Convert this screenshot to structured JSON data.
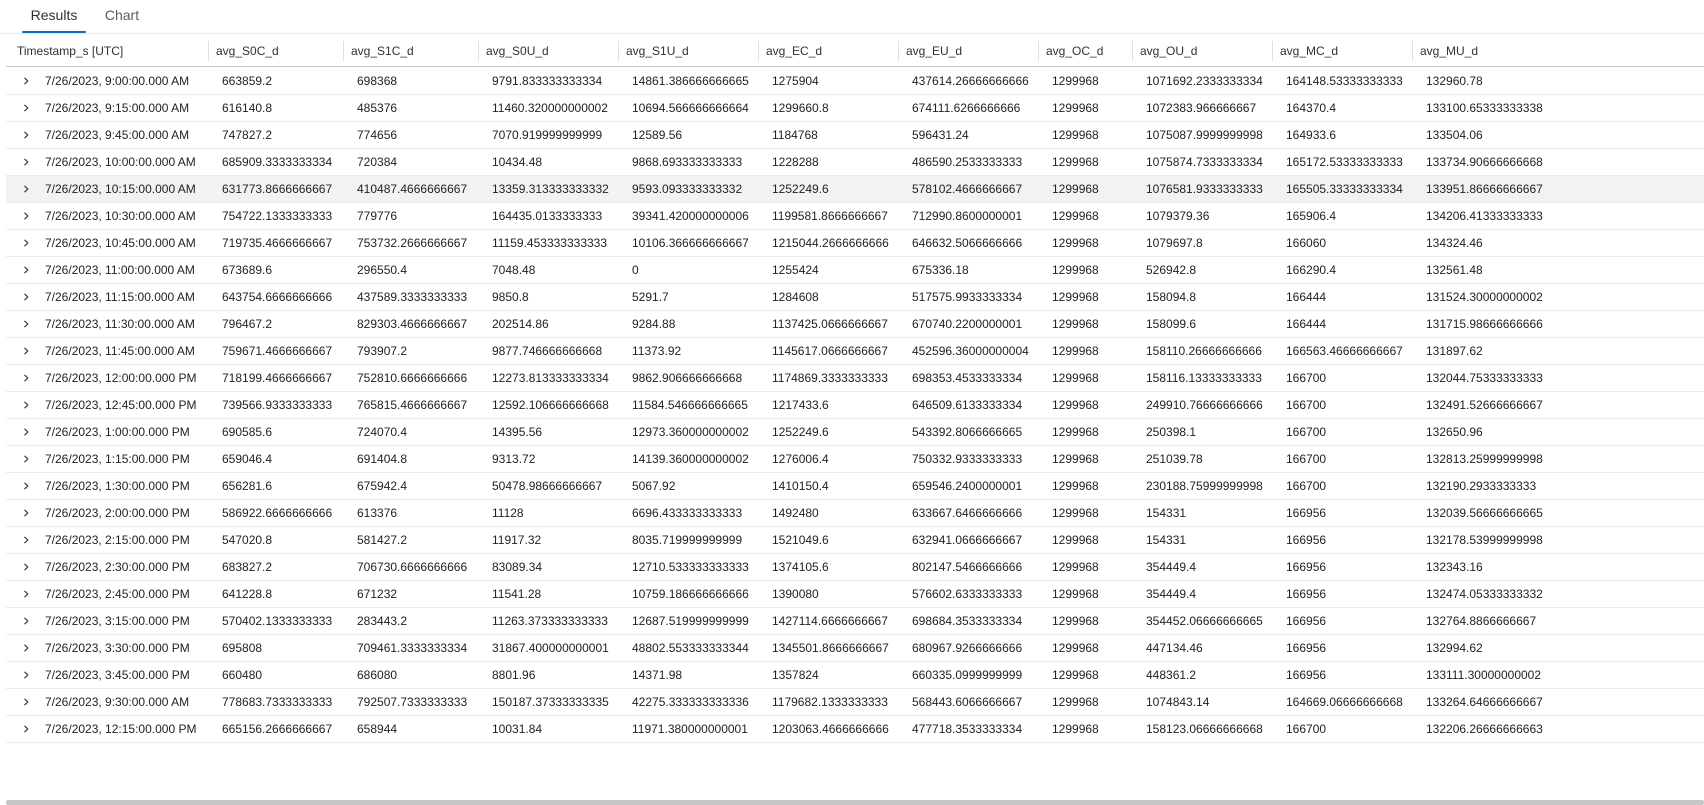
{
  "tabs": {
    "results_label": "Results",
    "chart_label": "Chart"
  },
  "columns": [
    "Timestamp_s [UTC]",
    "avg_S0C_d",
    "avg_S1C_d",
    "avg_S0U_d",
    "avg_S1U_d",
    "avg_EC_d",
    "avg_EU_d",
    "avg_OC_d",
    "avg_OU_d",
    "avg_MC_d",
    "avg_MU_d"
  ],
  "rows": [
    [
      "7/26/2023, 9:00:00.000 AM",
      "663859.2",
      "698368",
      "9791.833333333334",
      "14861.386666666665",
      "1275904",
      "437614.26666666666",
      "1299968",
      "1071692.2333333334",
      "164148.53333333333",
      "132960.78"
    ],
    [
      "7/26/2023, 9:15:00.000 AM",
      "616140.8",
      "485376",
      "11460.320000000002",
      "10694.566666666664",
      "1299660.8",
      "674111.6266666666",
      "1299968",
      "1072383.966666667",
      "164370.4",
      "133100.65333333338"
    ],
    [
      "7/26/2023, 9:45:00.000 AM",
      "747827.2",
      "774656",
      "7070.919999999999",
      "12589.56",
      "1184768",
      "596431.24",
      "1299968",
      "1075087.9999999998",
      "164933.6",
      "133504.06"
    ],
    [
      "7/26/2023, 10:00:00.000 AM",
      "685909.3333333334",
      "720384",
      "10434.48",
      "9868.693333333333",
      "1228288",
      "486590.2533333333",
      "1299968",
      "1075874.7333333334",
      "165172.53333333333",
      "133734.90666666668"
    ],
    [
      "7/26/2023, 10:15:00.000 AM",
      "631773.8666666667",
      "410487.4666666667",
      "13359.313333333332",
      "9593.093333333332",
      "1252249.6",
      "578102.4666666667",
      "1299968",
      "1076581.9333333333",
      "165505.33333333334",
      "133951.86666666667"
    ],
    [
      "7/26/2023, 10:30:00.000 AM",
      "754722.1333333333",
      "779776",
      "164435.0133333333",
      "39341.420000000006",
      "1199581.8666666667",
      "712990.8600000001",
      "1299968",
      "1079379.36",
      "165906.4",
      "134206.41333333333"
    ],
    [
      "7/26/2023, 10:45:00.000 AM",
      "719735.4666666667",
      "753732.2666666667",
      "11159.453333333333",
      "10106.366666666667",
      "1215044.2666666666",
      "646632.5066666666",
      "1299968",
      "1079697.8",
      "166060",
      "134324.46"
    ],
    [
      "7/26/2023, 11:00:00.000 AM",
      "673689.6",
      "296550.4",
      "7048.48",
      "0",
      "1255424",
      "675336.18",
      "1299968",
      "526942.8",
      "166290.4",
      "132561.48"
    ],
    [
      "7/26/2023, 11:15:00.000 AM",
      "643754.6666666666",
      "437589.3333333333",
      "9850.8",
      "5291.7",
      "1284608",
      "517575.9933333334",
      "1299968",
      "158094.8",
      "166444",
      "131524.30000000002"
    ],
    [
      "7/26/2023, 11:30:00.000 AM",
      "796467.2",
      "829303.4666666667",
      "202514.86",
      "9284.88",
      "1137425.0666666667",
      "670740.2200000001",
      "1299968",
      "158099.6",
      "166444",
      "131715.98666666666"
    ],
    [
      "7/26/2023, 11:45:00.000 AM",
      "759671.4666666667",
      "793907.2",
      "9877.746666666668",
      "11373.92",
      "1145617.0666666667",
      "452596.36000000004",
      "1299968",
      "158110.26666666666",
      "166563.46666666667",
      "131897.62"
    ],
    [
      "7/26/2023, 12:00:00.000 PM",
      "718199.4666666667",
      "752810.6666666666",
      "12273.813333333334",
      "9862.906666666668",
      "1174869.3333333333",
      "698353.4533333334",
      "1299968",
      "158116.13333333333",
      "166700",
      "132044.75333333333"
    ],
    [
      "7/26/2023, 12:45:00.000 PM",
      "739566.9333333333",
      "765815.4666666667",
      "12592.106666666668",
      "11584.546666666665",
      "1217433.6",
      "646509.6133333334",
      "1299968",
      "249910.76666666666",
      "166700",
      "132491.52666666667"
    ],
    [
      "7/26/2023, 1:00:00.000 PM",
      "690585.6",
      "724070.4",
      "14395.56",
      "12973.360000000002",
      "1252249.6",
      "543392.8066666665",
      "1299968",
      "250398.1",
      "166700",
      "132650.96"
    ],
    [
      "7/26/2023, 1:15:00.000 PM",
      "659046.4",
      "691404.8",
      "9313.72",
      "14139.360000000002",
      "1276006.4",
      "750332.9333333333",
      "1299968",
      "251039.78",
      "166700",
      "132813.25999999998"
    ],
    [
      "7/26/2023, 1:30:00.000 PM",
      "656281.6",
      "675942.4",
      "50478.98666666667",
      "5067.92",
      "1410150.4",
      "659546.2400000001",
      "1299968",
      "230188.75999999998",
      "166700",
      "132190.2933333333"
    ],
    [
      "7/26/2023, 2:00:00.000 PM",
      "586922.6666666666",
      "613376",
      "11128",
      "6696.433333333333",
      "1492480",
      "633667.6466666666",
      "1299968",
      "154331",
      "166956",
      "132039.56666666665"
    ],
    [
      "7/26/2023, 2:15:00.000 PM",
      "547020.8",
      "581427.2",
      "11917.32",
      "8035.719999999999",
      "1521049.6",
      "632941.0666666667",
      "1299968",
      "154331",
      "166956",
      "132178.53999999998"
    ],
    [
      "7/26/2023, 2:30:00.000 PM",
      "683827.2",
      "706730.6666666666",
      "83089.34",
      "12710.533333333333",
      "1374105.6",
      "802147.5466666666",
      "1299968",
      "354449.4",
      "166956",
      "132343.16"
    ],
    [
      "7/26/2023, 2:45:00.000 PM",
      "641228.8",
      "671232",
      "11541.28",
      "10759.186666666666",
      "1390080",
      "576602.6333333333",
      "1299968",
      "354449.4",
      "166956",
      "132474.05333333332"
    ],
    [
      "7/26/2023, 3:15:00.000 PM",
      "570402.1333333333",
      "283443.2",
      "11263.373333333333",
      "12687.519999999999",
      "1427114.6666666667",
      "698684.3533333334",
      "1299968",
      "354452.06666666665",
      "166956",
      "132764.8866666667"
    ],
    [
      "7/26/2023, 3:30:00.000 PM",
      "695808",
      "709461.3333333334",
      "31867.400000000001",
      "48802.553333333344",
      "1345501.8666666667",
      "680967.9266666666",
      "1299968",
      "447134.46",
      "166956",
      "132994.62"
    ],
    [
      "7/26/2023, 3:45:00.000 PM",
      "660480",
      "686080",
      "8801.96",
      "14371.98",
      "1357824",
      "660335.0999999999",
      "1299968",
      "448361.2",
      "166956",
      "133111.30000000002"
    ],
    [
      "7/26/2023, 9:30:00.000 AM",
      "778683.7333333333",
      "792507.7333333333",
      "150187.37333333335",
      "42275.333333333336",
      "1179682.1333333333",
      "568443.6066666667",
      "1299968",
      "1074843.14",
      "164669.06666666668",
      "133264.64666666667"
    ],
    [
      "7/26/2023, 12:15:00.000 PM",
      "665156.2666666667",
      "658944",
      "10031.84",
      "11971.380000000001",
      "1203063.4666666666",
      "477718.3533333334",
      "1299968",
      "158123.06666666668",
      "166700",
      "132206.26666666663"
    ]
  ],
  "highlighted_row_index": 4
}
